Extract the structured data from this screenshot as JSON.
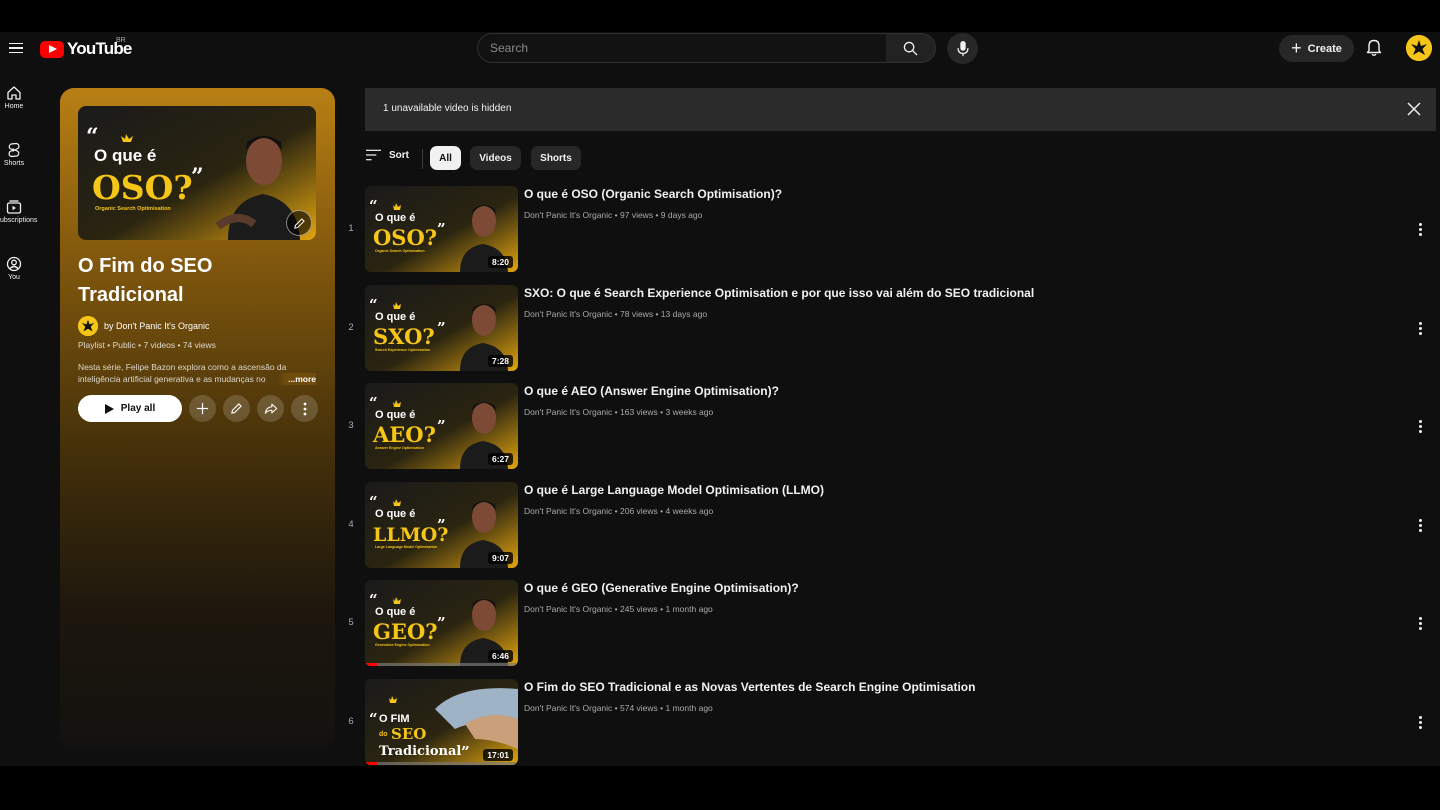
{
  "header": {
    "logo_text": "YouTube",
    "region": "BR",
    "search_placeholder": "Search",
    "create_label": "Create"
  },
  "guide": {
    "items": [
      {
        "label": "Home",
        "icon": "home-icon"
      },
      {
        "label": "Shorts",
        "icon": "shorts-icon"
      },
      {
        "label": "ubscriptions",
        "icon": "subscriptions-icon"
      },
      {
        "label": "You",
        "icon": "you-icon"
      }
    ]
  },
  "playlist": {
    "title": "O Fim do SEO Tradicional",
    "owner": "by Don't Panic It's Organic",
    "meta": "Playlist • Public • 7 videos • 74 views",
    "description": "Nesta série, Felipe Bazon explora como a ascensão da inteligência artificial generativa e as mudanças no",
    "more_label": "...more",
    "play_all_label": "Play all",
    "thumb_words": {
      "quote_open": "“",
      "line1": "O que é",
      "line2": "OSO?",
      "quote_close": "”",
      "subtitle": "Organic Search Optimisation"
    }
  },
  "notice": {
    "text": "1 unavailable video is hidden"
  },
  "filters": {
    "sort_label": "Sort",
    "chips": [
      {
        "label": "All",
        "active": true
      },
      {
        "label": "Videos",
        "active": false
      },
      {
        "label": "Shorts",
        "active": false
      }
    ]
  },
  "videos": [
    {
      "index": "1",
      "title": "O que é OSO (Organic Search Optimisation)?",
      "channel": "Don't Panic It's Organic",
      "views": "97 views",
      "age": "9 days ago",
      "duration": "8:20",
      "thumb_word": "OSO?",
      "thumb_sub": "Organic Search Optimisation",
      "progress": 0
    },
    {
      "index": "2",
      "title": "SXO: O que é Search Experience Optimisation e por que isso vai além do SEO tradicional",
      "channel": "Don't Panic It's Organic",
      "views": "78 views",
      "age": "13 days ago",
      "duration": "7:28",
      "thumb_word": "SXO?",
      "thumb_sub": "Search Experience Optimisation",
      "progress": 0
    },
    {
      "index": "3",
      "title": "O que é AEO (Answer Engine Optimisation)?",
      "channel": "Don't Panic It's Organic",
      "views": "163 views",
      "age": "3 weeks ago",
      "duration": "6:27",
      "thumb_word": "AEO?",
      "thumb_sub": "Answer Engine Optimisation",
      "progress": 0
    },
    {
      "index": "4",
      "title": "O que é Large Language Model Optimisation (LLMO)",
      "channel": "Don't Panic It's Organic",
      "views": "206 views",
      "age": "4 weeks ago",
      "duration": "9:07",
      "thumb_word": "LLMO?",
      "thumb_sub": "Large Language Model Optimisation",
      "progress": 0
    },
    {
      "index": "5",
      "title": "O que é GEO (Generative Engine Optimisation)?",
      "channel": "Don't Panic It's Organic",
      "views": "245 views",
      "age": "1 month ago",
      "duration": "6:46",
      "thumb_word": "GEO?",
      "thumb_sub": "Generative Engine Optimisation",
      "progress": 0.08
    },
    {
      "index": "6",
      "title": "O Fim do SEO Tradicional e as Novas Vertentes de Search Engine Optimisation",
      "channel": "Don't Panic It's Organic",
      "views": "574 views",
      "age": "1 month ago",
      "duration": "17:01",
      "thumb_word": "Tradicional",
      "thumb_sub": "",
      "progress": 0.08
    }
  ],
  "thumb_common": {
    "line1": "O que é",
    "alt_line1": "O FIM",
    "alt_line2": "do",
    "alt_line3": "SEO"
  },
  "colors": {
    "accent_yellow": "#f5c518",
    "brand_red": "#ff0000",
    "background": "#0f0f0f"
  }
}
